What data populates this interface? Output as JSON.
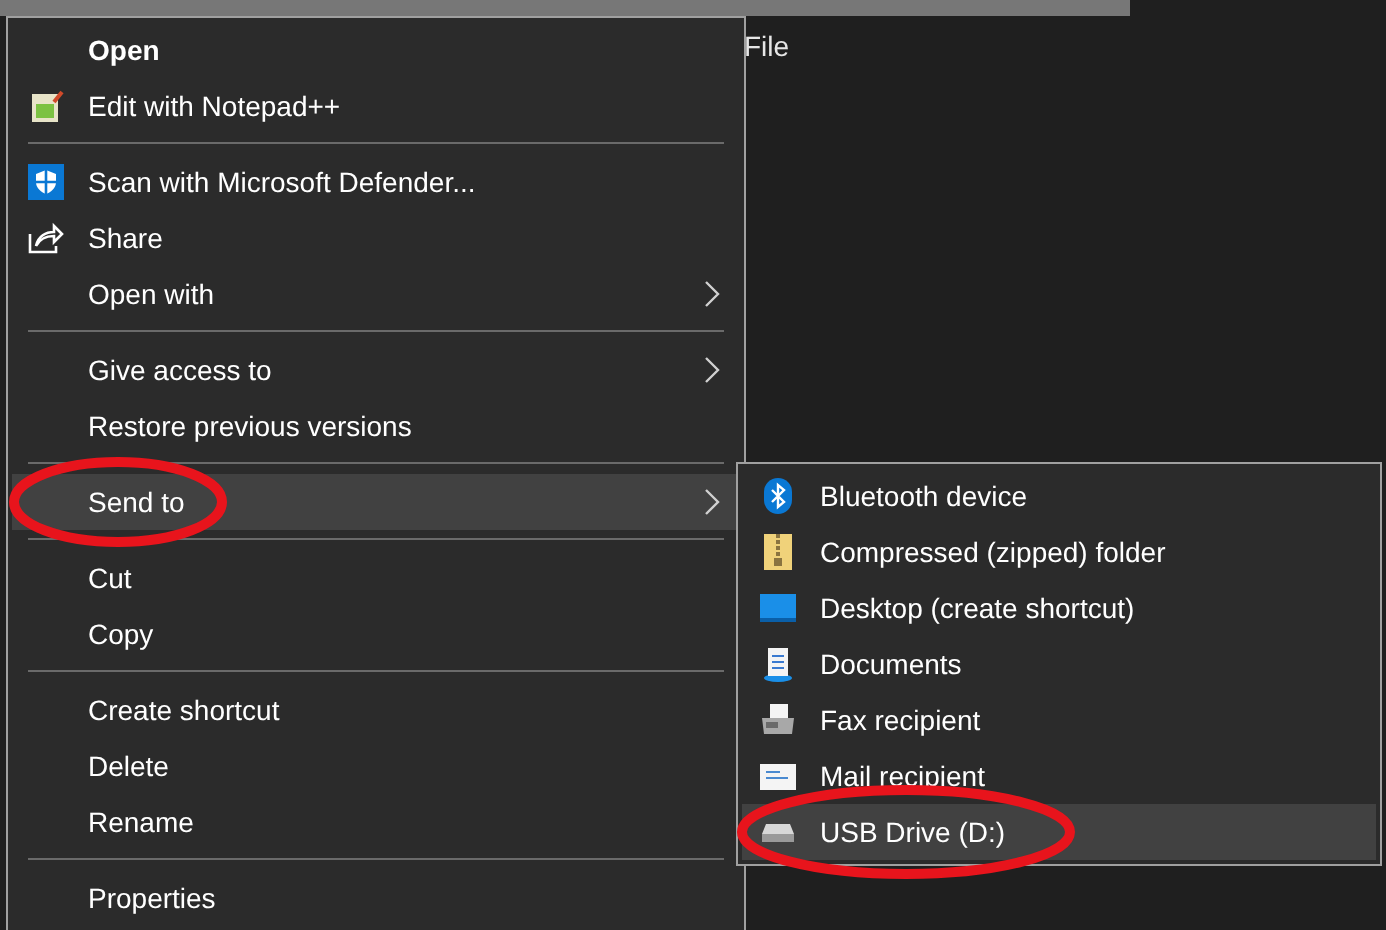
{
  "background_text": "File",
  "menu": {
    "items": [
      {
        "kind": "item",
        "label": "Open",
        "bold": true,
        "submenu": false,
        "selected": false,
        "circled": false
      },
      {
        "kind": "item",
        "label": "Edit with Notepad++",
        "bold": false,
        "submenu": false,
        "selected": false,
        "circled": false
      },
      {
        "kind": "separator"
      },
      {
        "kind": "item",
        "label": "Scan with Microsoft Defender...",
        "bold": false,
        "submenu": false,
        "selected": false,
        "circled": false
      },
      {
        "kind": "item",
        "label": "Share",
        "bold": false,
        "submenu": false,
        "selected": false,
        "circled": false
      },
      {
        "kind": "item",
        "label": "Open with",
        "bold": false,
        "submenu": true,
        "selected": false,
        "circled": false
      },
      {
        "kind": "separator"
      },
      {
        "kind": "item",
        "label": "Give access to",
        "bold": false,
        "submenu": true,
        "selected": false,
        "circled": false
      },
      {
        "kind": "item",
        "label": "Restore previous versions",
        "bold": false,
        "submenu": false,
        "selected": false,
        "circled": false
      },
      {
        "kind": "separator"
      },
      {
        "kind": "item",
        "label": "Send to",
        "bold": false,
        "submenu": true,
        "selected": true,
        "circled": true
      },
      {
        "kind": "separator"
      },
      {
        "kind": "item",
        "label": "Cut",
        "bold": false,
        "submenu": false,
        "selected": false,
        "circled": false
      },
      {
        "kind": "item",
        "label": "Copy",
        "bold": false,
        "submenu": false,
        "selected": false,
        "circled": false
      },
      {
        "kind": "separator"
      },
      {
        "kind": "item",
        "label": "Create shortcut",
        "bold": false,
        "submenu": false,
        "selected": false,
        "circled": false
      },
      {
        "kind": "item",
        "label": "Delete",
        "bold": false,
        "submenu": false,
        "selected": false,
        "circled": false
      },
      {
        "kind": "item",
        "label": "Rename",
        "bold": false,
        "submenu": false,
        "selected": false,
        "circled": false
      },
      {
        "kind": "separator"
      },
      {
        "kind": "item",
        "label": "Properties",
        "bold": false,
        "submenu": false,
        "selected": false,
        "circled": false
      }
    ]
  },
  "send_to": {
    "items": [
      {
        "label": "Bluetooth device",
        "selected": false,
        "circled": false
      },
      {
        "label": "Compressed (zipped) folder",
        "selected": false,
        "circled": false
      },
      {
        "label": "Desktop (create shortcut)",
        "selected": false,
        "circled": false
      },
      {
        "label": "Documents",
        "selected": false,
        "circled": false
      },
      {
        "label": "Fax recipient",
        "selected": false,
        "circled": false
      },
      {
        "label": "Mail recipient",
        "selected": false,
        "circled": false
      },
      {
        "label": "USB Drive (D:)",
        "selected": true,
        "circled": true
      }
    ]
  }
}
